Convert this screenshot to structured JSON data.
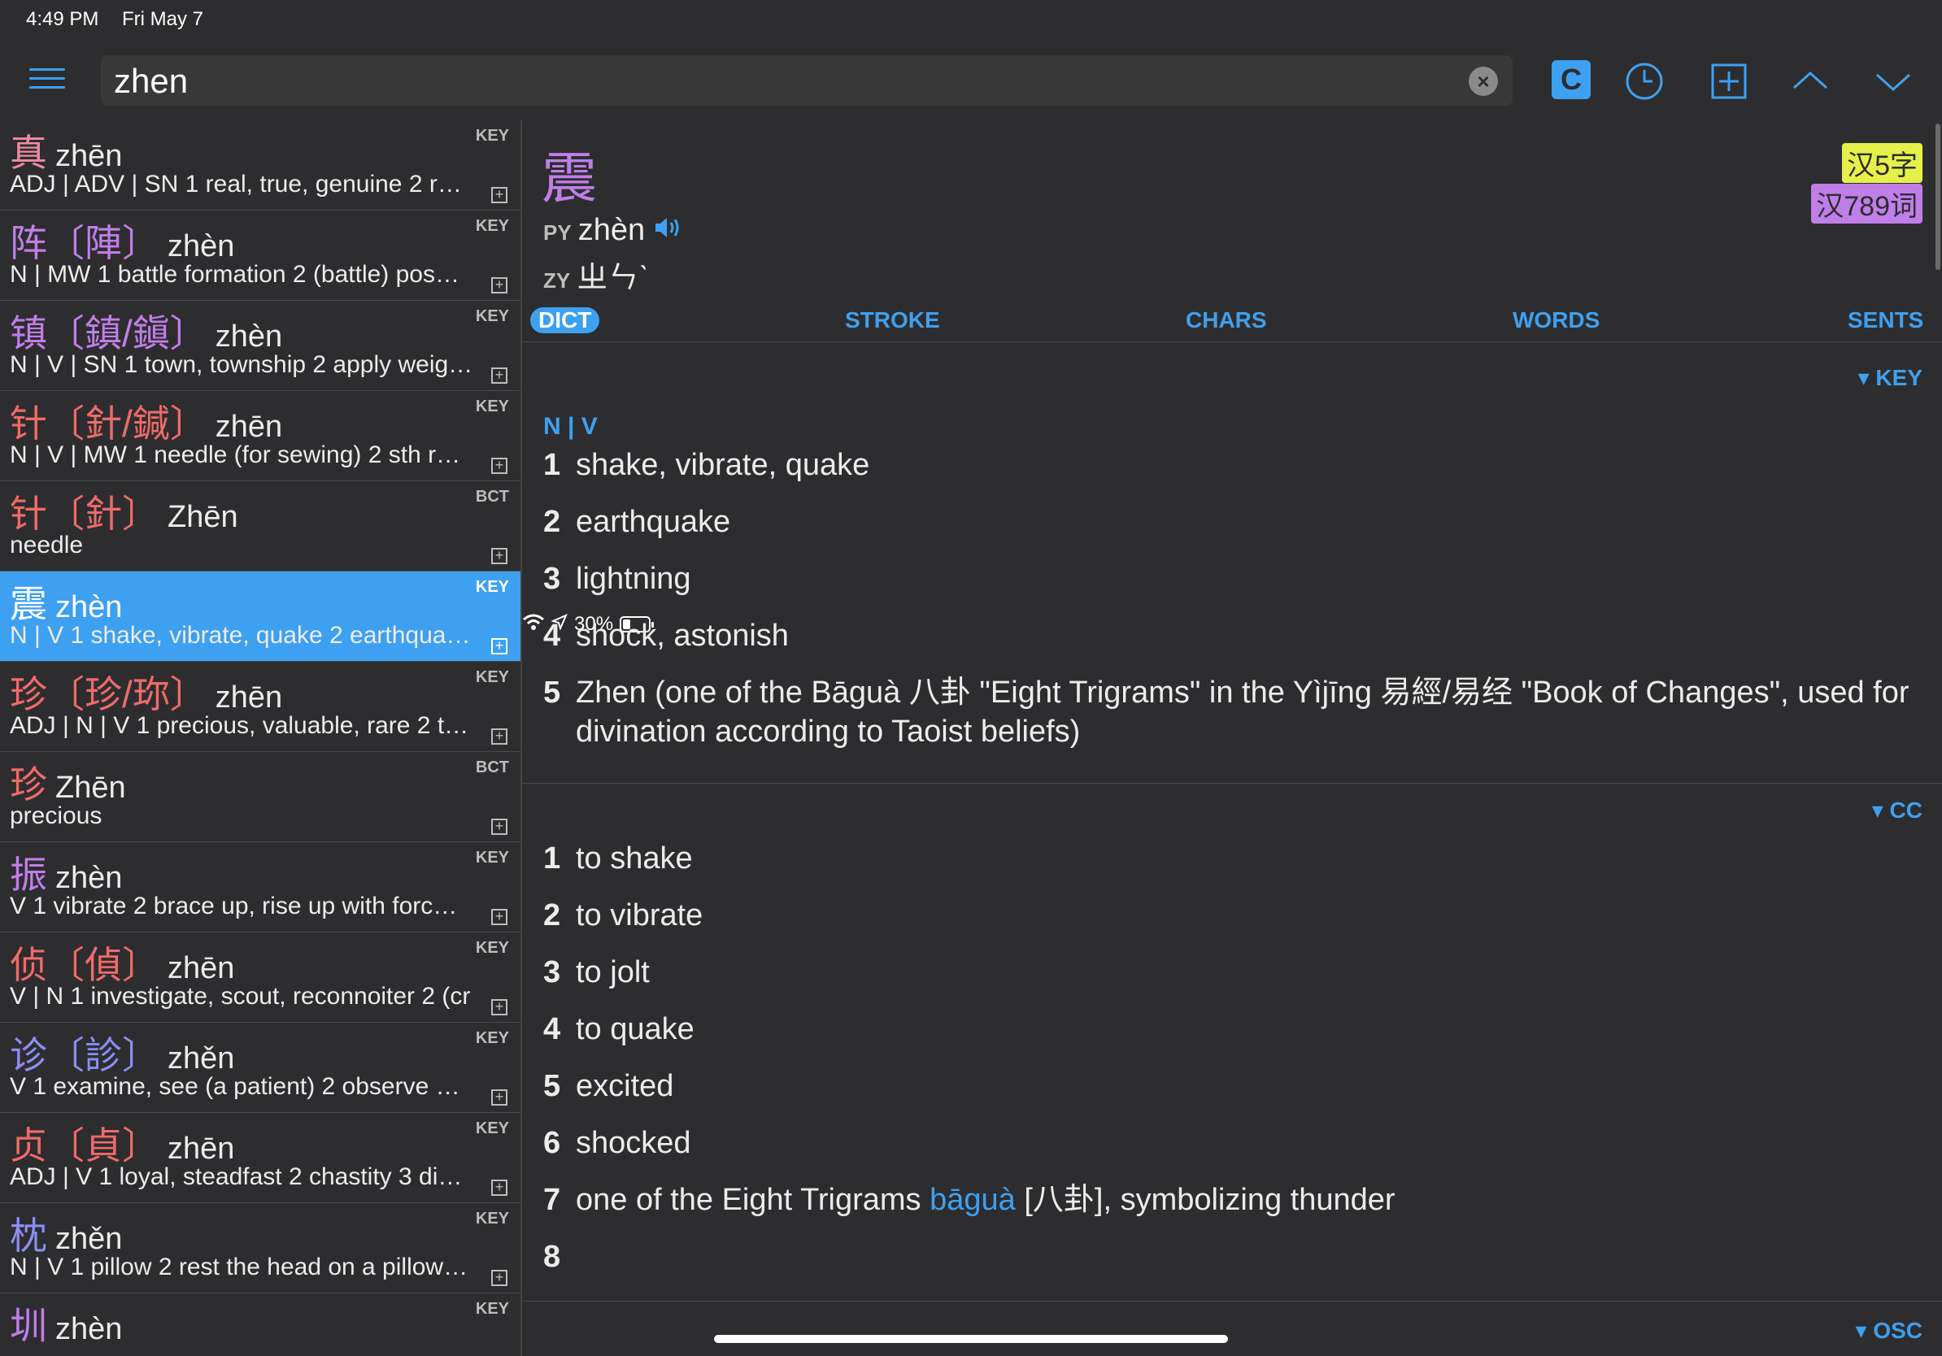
{
  "status": {
    "time": "4:49 PM",
    "date": "Fri May 7",
    "battery": "30%",
    "battery_level": 0.3
  },
  "search": {
    "value": "zhen"
  },
  "toolbar": {
    "c_label": "C"
  },
  "entries": [
    {
      "char": "真",
      "trad": "",
      "py": "zhēn",
      "tag": "KEY",
      "def": "ADJ | ADV | SN  1 real, true, genuine  2 re…",
      "color": "pink"
    },
    {
      "char": "阵",
      "trad": "〔陣〕",
      "py": "zhèn",
      "tag": "KEY",
      "def": "N | MW  1 battle formation  2 (battle) pos…",
      "color": "violet"
    },
    {
      "char": "镇",
      "trad": "〔鎮/鎭〕",
      "py": "zhèn",
      "tag": "KEY",
      "def": "N | V | SN  1 town, township  2 apply weig…",
      "color": "violet"
    },
    {
      "char": "针",
      "trad": "〔針/鍼〕",
      "py": "zhēn",
      "tag": "KEY",
      "def": "N | V | MW  1 needle (for sewing)  2 sth re…",
      "color": "red"
    },
    {
      "char": "针",
      "trad": "〔針〕",
      "py": "Zhēn",
      "tag": "BCT",
      "def": "needle",
      "color": "red"
    },
    {
      "char": "震",
      "trad": "",
      "py": "zhèn",
      "tag": "KEY",
      "def": "N | V  1 shake, vibrate, quake  2 earthqua…",
      "color": "violet",
      "selected": true
    },
    {
      "char": "珍",
      "trad": "〔珍/珎〕",
      "py": "zhēn",
      "tag": "KEY",
      "def": "ADJ | N | V  1 precious, valuable, rare  2 tr…",
      "color": "red"
    },
    {
      "char": "珍",
      "trad": "",
      "py": "Zhēn",
      "tag": "BCT",
      "def": "precious",
      "color": "red"
    },
    {
      "char": "振",
      "trad": "",
      "py": "zhèn",
      "tag": "KEY",
      "def": "V  1 vibrate  2 brace up, rise up with forc…",
      "color": "violet"
    },
    {
      "char": "侦",
      "trad": "〔偵〕",
      "py": "zhēn",
      "tag": "KEY",
      "def": "V | N  1 investigate, scout, reconnoiter  2 (cr",
      "color": "red"
    },
    {
      "char": "诊",
      "trad": "〔診〕",
      "py": "zhěn",
      "tag": "KEY",
      "def": "V  1 examine, see (a patient)  2 observe a…",
      "color": "blue"
    },
    {
      "char": "贞",
      "trad": "〔貞〕",
      "py": "zhēn",
      "tag": "KEY",
      "def": "ADJ | V  1 loyal, steadfast  2 chastity  3 di…",
      "color": "red"
    },
    {
      "char": "枕",
      "trad": "",
      "py": "zhěn",
      "tag": "KEY",
      "def": "N | V  1 pillow  2 rest the head on a pillow…",
      "color": "blue"
    },
    {
      "char": "圳",
      "trad": "",
      "py": "zhèn",
      "tag": "KEY",
      "def": "",
      "color": "violet"
    }
  ],
  "detail": {
    "char": "震",
    "py_label": "PY",
    "py": "zhèn",
    "zy_label": "ZY",
    "zy": "ㄓㄣˋ",
    "badge1": "汉5字",
    "badge2": "汉789词",
    "tabs": [
      "DICT",
      "STROKE",
      "CHARS",
      "WORDS",
      "SENTS"
    ],
    "key_hdr": "▾ KEY",
    "pos": "N | V",
    "key_senses": [
      "shake, vibrate, quake",
      "earthquake",
      "lightning",
      "shock, astonish",
      "Zhen (one of the Bāguà 八卦 \"Eight Trigrams\" in the Yìjīng 易經/易经 \"Book of Changes\", used for divination according to Taoist beliefs)"
    ],
    "cc_hdr": "▾ CC",
    "cc_senses": [
      "to shake",
      "to vibrate",
      "to jolt",
      "to quake",
      "excited",
      "shocked"
    ],
    "cc7_pre": "one of the Eight Trigrams ",
    "cc7_link": "bāguà",
    "cc7_post": " [八卦], symbolizing thunder",
    "osc_hdr": "▾ OSC"
  }
}
